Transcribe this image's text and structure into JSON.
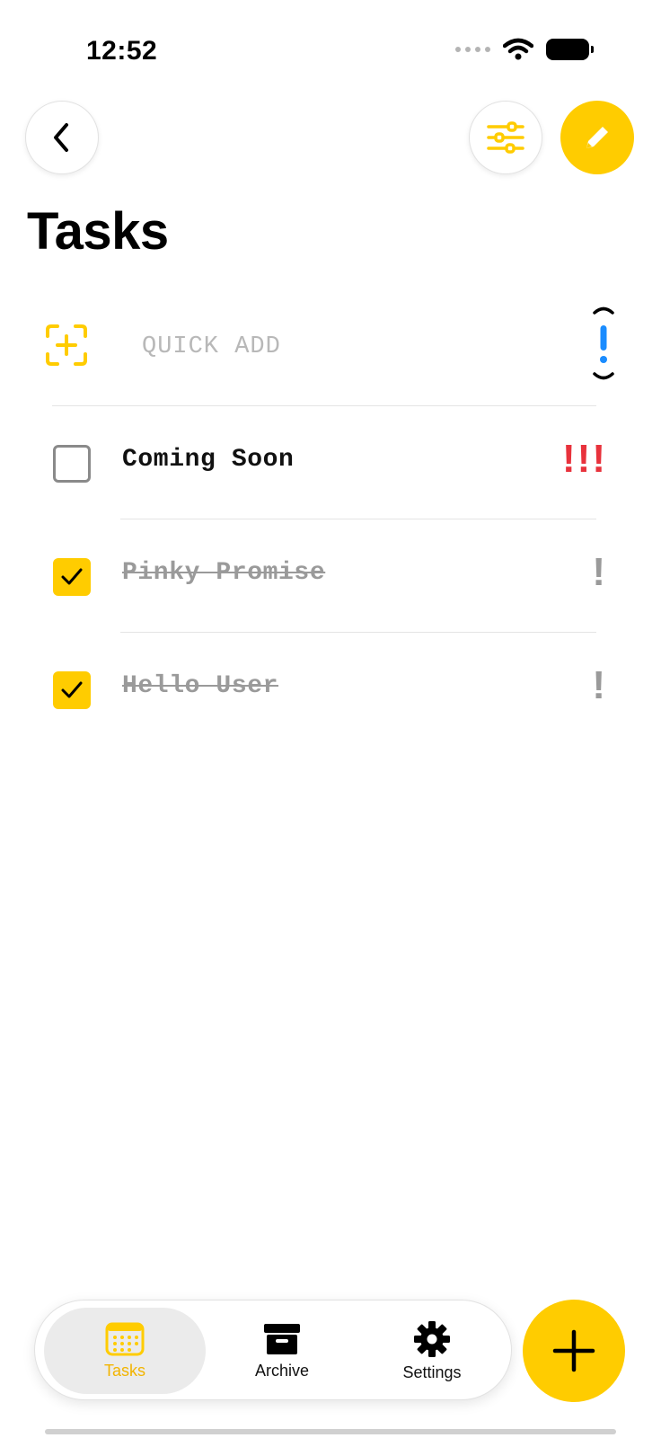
{
  "status_bar": {
    "time": "12:52"
  },
  "header": {
    "title": "Tasks"
  },
  "quick_add": {
    "placeholder": "QUICK ADD",
    "value": ""
  },
  "tasks": [
    {
      "title": "Coming Soon",
      "done": false,
      "priority": "!!!",
      "priority_color": "#e8323c"
    },
    {
      "title": "Pinky Promise",
      "done": true,
      "priority": "!",
      "priority_color": "#9a9a9a"
    },
    {
      "title": "Hello User",
      "done": true,
      "priority": "!",
      "priority_color": "#9a9a9a"
    }
  ],
  "tabbar": {
    "tasks_label": "Tasks",
    "archive_label": "Archive",
    "settings_label": "Settings"
  },
  "colors": {
    "accent": "#ffcc00",
    "priority_high": "#e8323c",
    "priority_marker": "#1a8cff"
  }
}
